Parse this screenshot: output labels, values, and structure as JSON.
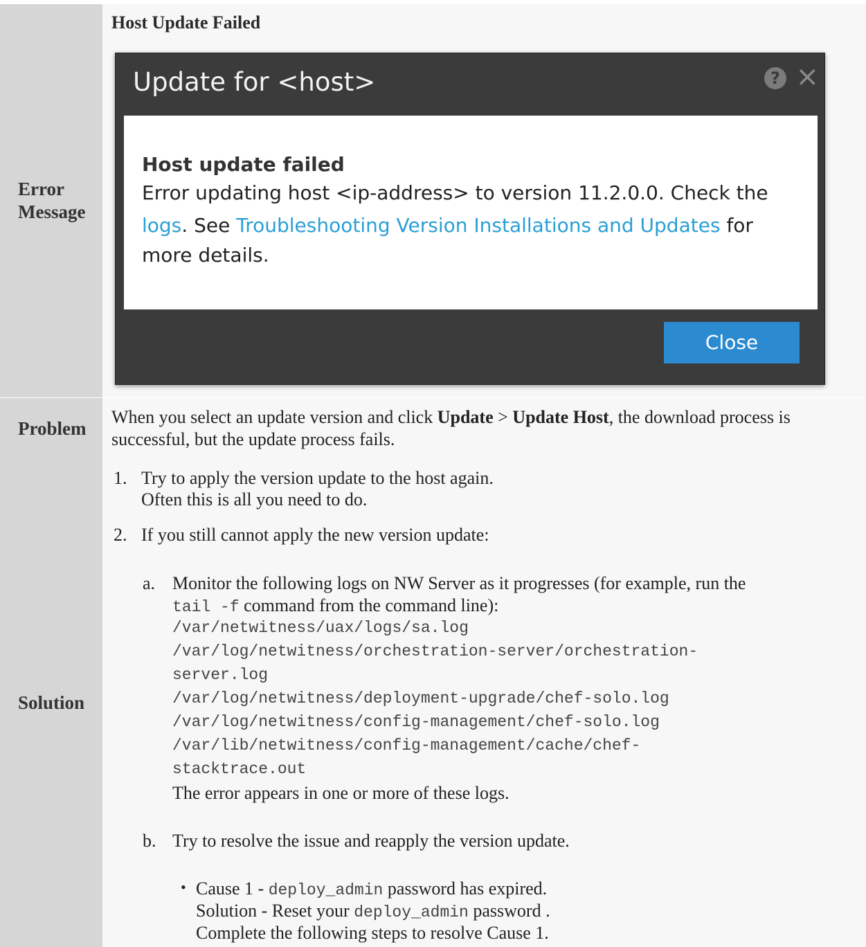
{
  "error_row": {
    "label": "Error Message",
    "heading": "Host Update Failed",
    "dialog": {
      "title": "Update for <host>",
      "help_icon": "?",
      "close_icon": "×",
      "message_title": "Host update failed",
      "message_line1": "Error updating host <ip-address> to version 11.2.0.0. Check the",
      "link_logs": "logs",
      "text_see": ". See ",
      "link_troubleshooting": "Troubleshooting Version Installations and Updates",
      "text_for": " for",
      "message_line3": "more details.",
      "close_button": "Close"
    }
  },
  "problem_row": {
    "label": "Problem",
    "text_1": "When you select an update version and click ",
    "bold_1": "Update",
    "text_2": " > ",
    "bold_2": "Update Host",
    "text_3": ", the download process is successful, but the update process fails."
  },
  "solution_row": {
    "label": "Solution",
    "step1_num": "1.",
    "step1_line1": "Try to apply the version update to the host again.",
    "step1_line2": "Often this is all you need to do.",
    "step2_num": "2.",
    "step2_text": "If you still cannot apply the new version update:",
    "a_num": "a.",
    "a_line1": "Monitor the following logs on NW Server as it progresses (for example, run the",
    "a_cmd": "tail -f",
    "a_line2_rest": " command from the command line):",
    "logs": [
      "/var/netwitness/uax/logs/sa.log",
      "/var/log/netwitness/orchestration-server/orchestration-",
      "server.log",
      "/var/log/netwitness/deployment-upgrade/chef-solo.log",
      "/var/log/netwitness/config-management/chef-solo.log",
      "/var/lib/netwitness/config-management/cache/chef-",
      "stacktrace.out"
    ],
    "a_after": "The error appears in one or more of these logs.",
    "b_num": "b.",
    "b_text": "Try to resolve the issue and reapply the version update.",
    "bullet": "•",
    "cause_prefix": "Cause 1 - ",
    "cause_code": "deploy_admin",
    "cause_suffix": " password has expired.",
    "solution_prefix": "Solution - Reset your ",
    "solution_code": "deploy_admin",
    "solution_suffix": " password .",
    "complete_text": "Complete the following steps to resolve Cause 1."
  }
}
